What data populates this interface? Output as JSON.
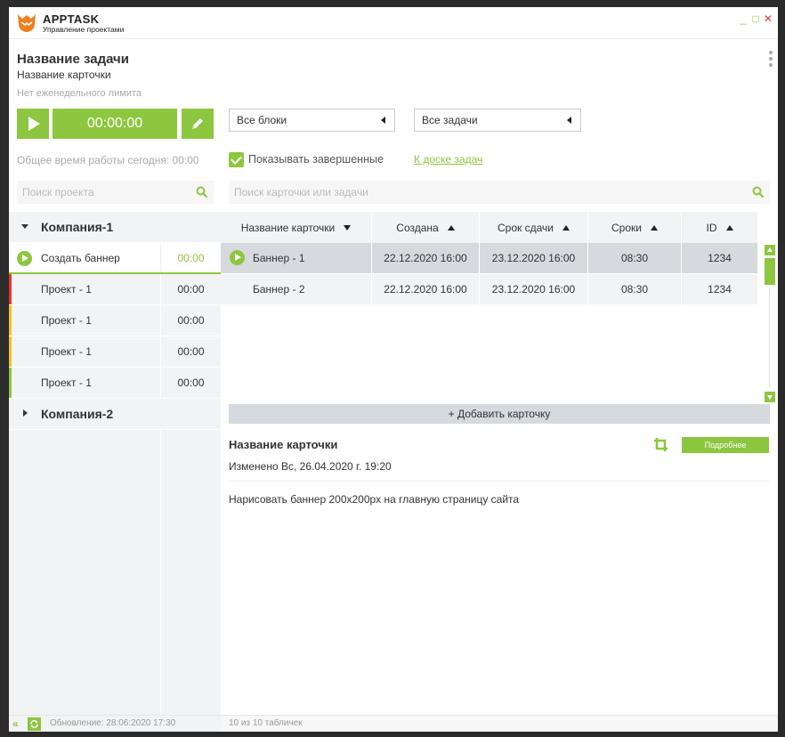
{
  "app": {
    "name": "APPTASK",
    "subtitle": "Управление проектами"
  },
  "window_controls": {
    "minimize": "_",
    "maximize": "□",
    "close": "✕"
  },
  "task": {
    "title": "Название задачи",
    "card_title": "Название карточки",
    "weekly_limit": "Нет еженедельного лимита",
    "timer": "00:00:00",
    "today_total": "Общее время работы сегодня: 00:00"
  },
  "project_search": {
    "placeholder": "Поиск проекта"
  },
  "tree": {
    "company1": "Компания-1",
    "company2": "Компания-2",
    "projects": [
      {
        "name": "Создать баннер",
        "time": "00:00",
        "color": ""
      },
      {
        "name": "Проект - 1",
        "time": "00:00",
        "color": "#e53935"
      },
      {
        "name": "Проект - 1",
        "time": "00:00",
        "color": "#f0c419"
      },
      {
        "name": "Проект - 1",
        "time": "00:00",
        "color": "#f0c419"
      },
      {
        "name": "Проект - 1",
        "time": "00:00",
        "color": "#8dc63f"
      }
    ]
  },
  "status": {
    "updated": "Обновление: 28:06:2020 17:30",
    "count": "10 из 10 табличек"
  },
  "filters": {
    "blocks": "Все блоки",
    "tasks": "Все задачи",
    "show_completed": "Показывать завершенные",
    "board_link": "К доске задач"
  },
  "card_search": {
    "placeholder": "Поиск карточки или задачи"
  },
  "table": {
    "headers": [
      "Название карточки",
      "Создана",
      "Срок сдачи",
      "Сроки",
      "ID"
    ],
    "rows": [
      {
        "name": "Баннер - 1",
        "created": "22.12.2020 16:00",
        "due": "23.12.2020 16:00",
        "term": "08:30",
        "id": "1234"
      },
      {
        "name": "Баннер - 2",
        "created": "22.12.2020 16:00",
        "due": "23.12.2020 16:00",
        "term": "08:30",
        "id": "1234"
      }
    ]
  },
  "add_card": "+ Добавить карточку",
  "detail": {
    "title": "Название карточки",
    "more": "Подробнее",
    "modified": "Изменено Вс, 26.04.2020 г. 19:20",
    "description": "Нарисовать баннер 200x200px на главную страницу сайта"
  },
  "colors": {
    "accent": "#8dc63f",
    "red": "#e53935",
    "yellow": "#f0c419"
  },
  "icons": [
    "logo-icon",
    "play-icon",
    "pencil-icon",
    "search-icon",
    "crop-icon",
    "double-chevron-left-icon",
    "refresh-icon",
    "kebab-icon"
  ]
}
